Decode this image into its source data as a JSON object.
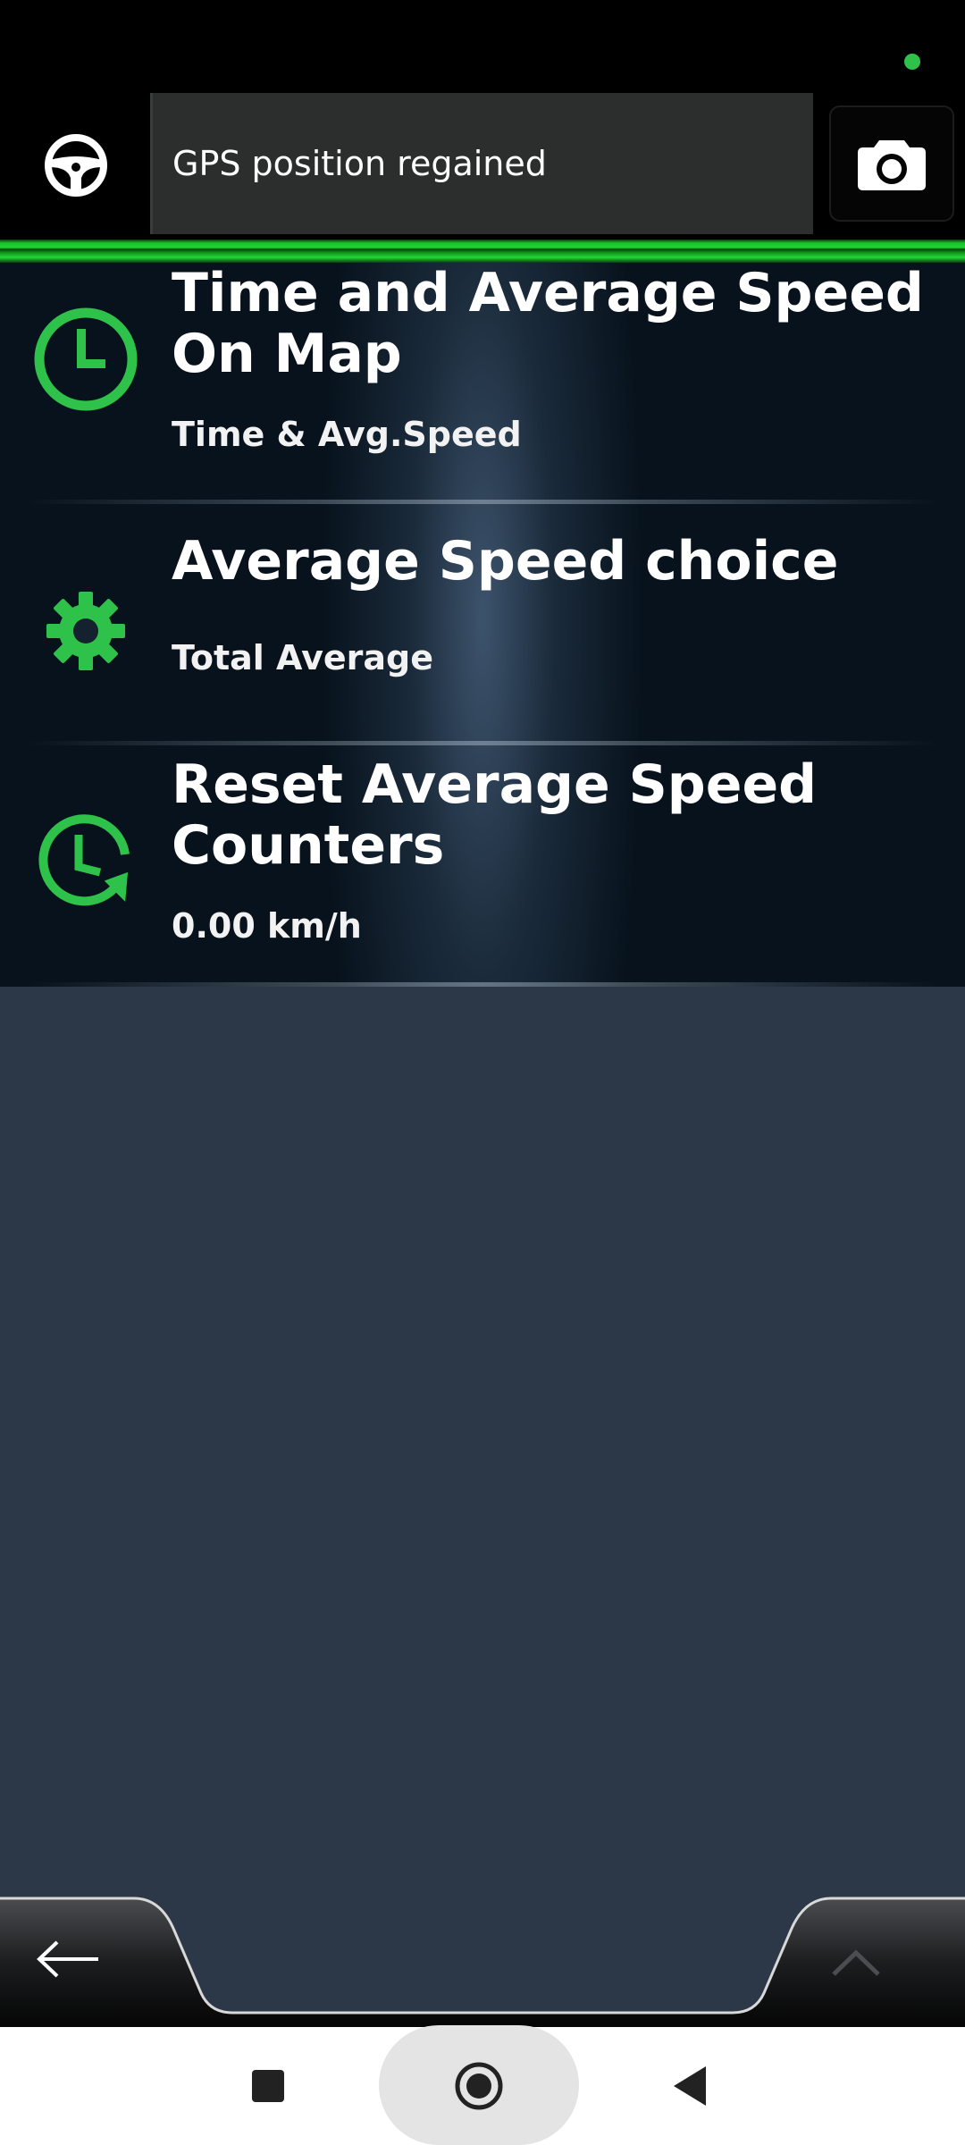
{
  "toast": {
    "text": "GPS position regained"
  },
  "colors": {
    "accent_green": "#2ec24a",
    "background": "#2c3847",
    "topbar": "#000000"
  },
  "icons": {
    "left": "steering-wheel-icon",
    "right": "camera-icon"
  },
  "settings": [
    {
      "title": "Time and Average Speed On Map",
      "subtitle": "Time & Avg.Speed",
      "icon": "clock-icon"
    },
    {
      "title": "Average Speed choice",
      "subtitle": "Total Average",
      "icon": "gear-icon"
    },
    {
      "title": "Reset Average Speed Counters",
      "subtitle": "0.00 km/h",
      "icon": "history-reset-icon"
    }
  ],
  "bottom_bar": {
    "left": "arrow-left-icon",
    "right": "chevron-up-icon"
  },
  "system_nav": [
    "recents-square-icon",
    "home-circle-icon",
    "back-triangle-icon"
  ]
}
